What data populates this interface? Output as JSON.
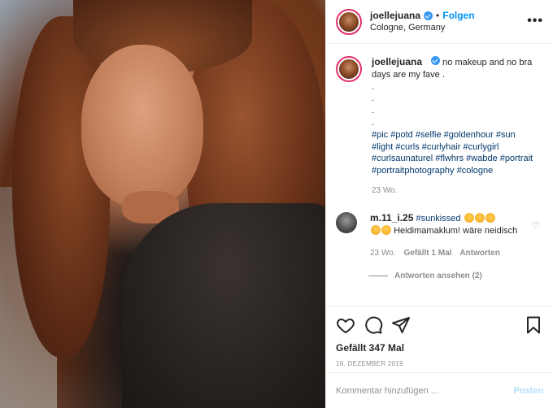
{
  "post": {
    "username": "joellejuana",
    "follow_label": "Folgen",
    "location": "Cologne, Germany",
    "more_icon": "more-horizontal-icon"
  },
  "caption": {
    "username": "joellejuana",
    "text": "no makeup and no bra days are my fave .",
    "dots": [
      ".",
      ".",
      ".",
      "."
    ],
    "hashtags": "#pic #potd #selfie #goldenhour #sun #light #curls #curlyhair #curlygirl #curlsaunaturel #flwhrs #wabde #portrait #portraitphotography #cologne",
    "age": "23 Wo."
  },
  "comment": {
    "username": "m.11_i.25",
    "hashtag": "#sunkissed",
    "text": "Heidimamaklum! wäre neidisch",
    "age": "23 Wo.",
    "likes": "Gefällt 1 Mal",
    "reply": "Antworten",
    "view_replies": "Antworten ansehen (2)"
  },
  "actions": {
    "likes": "Gefällt 347 Mal",
    "date": "16. DEZEMBER 2019"
  },
  "add_comment": {
    "placeholder": "Kommentar hinzufügen ...",
    "post_label": "Posten"
  },
  "colors": {
    "link_blue": "#0095f6",
    "hashtag": "#00376b",
    "muted": "#8e8e8e",
    "post_disabled": "#b2dffc"
  }
}
